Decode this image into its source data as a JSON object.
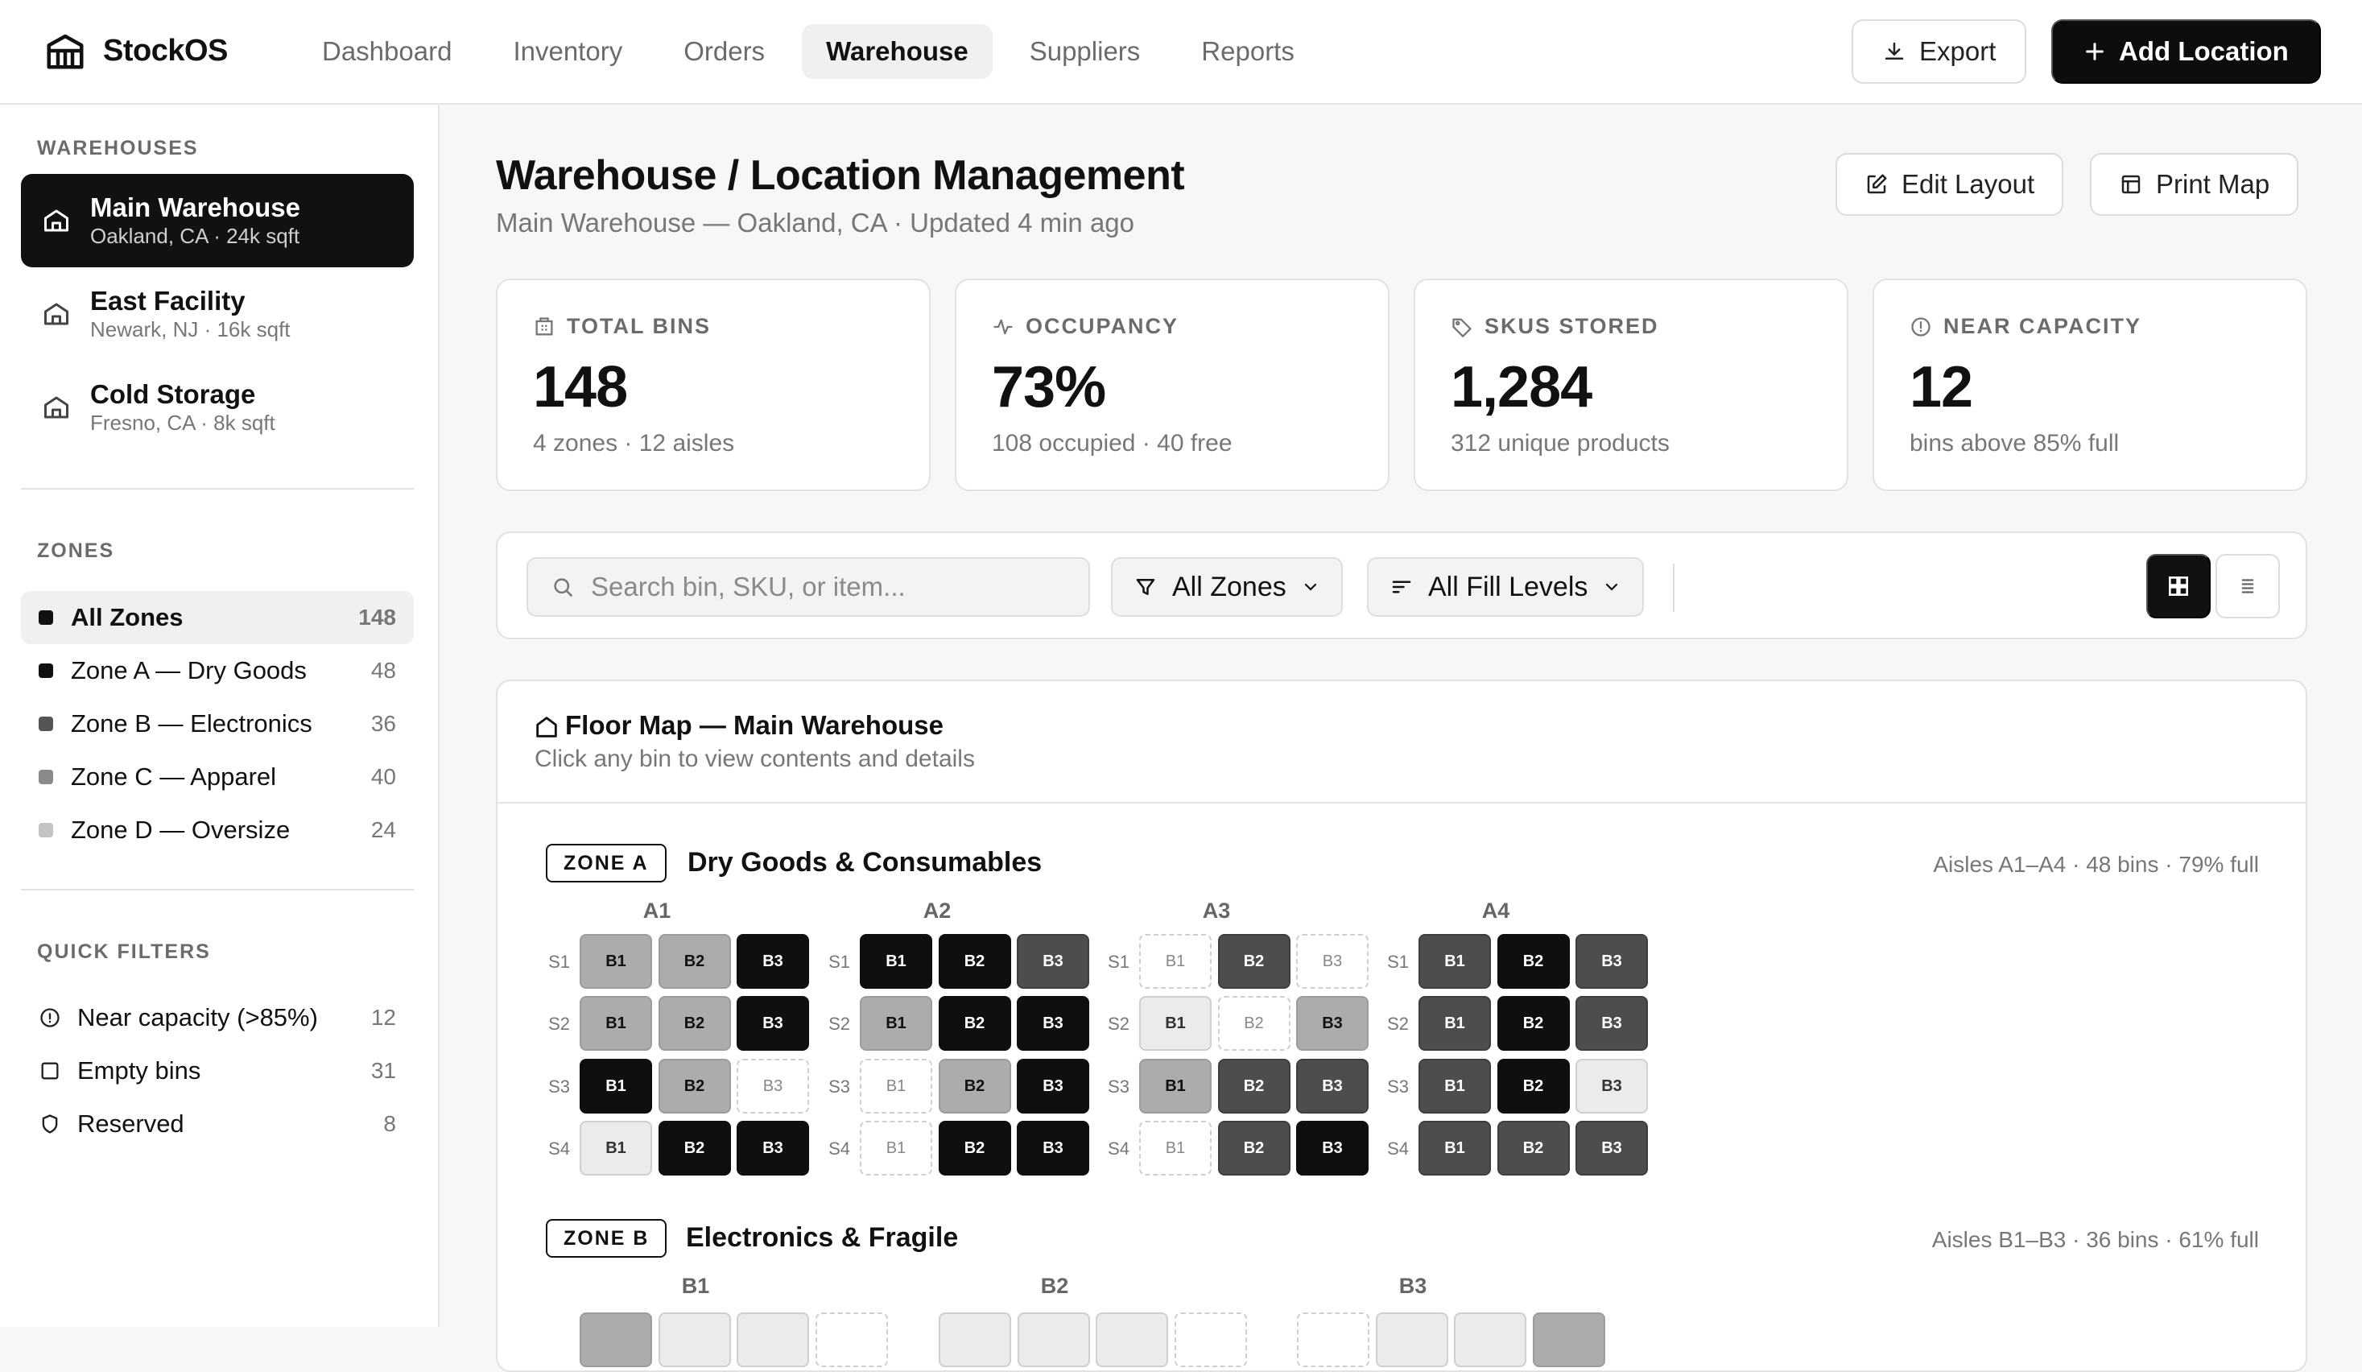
{
  "app": {
    "name": "StockOS"
  },
  "nav": {
    "items": [
      {
        "label": "Dashboard"
      },
      {
        "label": "Inventory"
      },
      {
        "label": "Orders"
      },
      {
        "label": "Warehouse",
        "active": true
      },
      {
        "label": "Suppliers"
      },
      {
        "label": "Reports"
      }
    ],
    "export_label": "Export",
    "add_label": "Add Location"
  },
  "sidebar": {
    "warehouses_heading": "WAREHOUSES",
    "warehouses": [
      {
        "name": "Main Warehouse",
        "meta": "Oakland, CA · 24k sqft",
        "active": true
      },
      {
        "name": "East Facility",
        "meta": "Newark, NJ · 16k sqft"
      },
      {
        "name": "Cold Storage",
        "meta": "Fresno, CA · 8k sqft"
      }
    ],
    "zones_heading": "ZONES",
    "zones": [
      {
        "label": "All Zones",
        "count": "148",
        "color": "#111111",
        "active": true
      },
      {
        "label": "Zone A — Dry Goods",
        "count": "48",
        "color": "#111111"
      },
      {
        "label": "Zone B — Electronics",
        "count": "36",
        "color": "#555555"
      },
      {
        "label": "Zone C — Apparel",
        "count": "40",
        "color": "#8a8a8a"
      },
      {
        "label": "Zone D — Oversize",
        "count": "24",
        "color": "#c4c4c4"
      }
    ],
    "quick_filters_heading": "QUICK FILTERS",
    "quick_filters": [
      {
        "label": "Near capacity (>85%)",
        "count": "12",
        "icon": "alert-circle-icon"
      },
      {
        "label": "Empty bins",
        "count": "31",
        "icon": "square-icon"
      },
      {
        "label": "Reserved",
        "count": "8",
        "icon": "shield-icon"
      }
    ]
  },
  "page": {
    "title": "Warehouse / Location Management",
    "subtitle": "Main Warehouse — Oakland, CA · Updated 4 min ago",
    "edit_label": "Edit Layout",
    "print_label": "Print Map"
  },
  "stats": [
    {
      "label": "TOTAL BINS",
      "value": "148",
      "sub": "4 zones · 12 aisles",
      "icon": "building-icon"
    },
    {
      "label": "OCCUPANCY",
      "value": "73%",
      "sub": "108 occupied · 40 free",
      "icon": "activity-icon"
    },
    {
      "label": "SKUS STORED",
      "value": "1,284",
      "sub": "312 unique products",
      "icon": "tag-icon"
    },
    {
      "label": "NEAR CAPACITY",
      "value": "12",
      "sub": "bins above 85% full",
      "icon": "alert-circle-icon"
    }
  ],
  "toolbar": {
    "search_placeholder": "Search bin, SKU, or item...",
    "zone_filter": "All Zones",
    "fill_filter": "All Fill Levels"
  },
  "floor_map": {
    "title": "Floor Map — Main Warehouse",
    "subtitle": "Click any bin to view contents and details",
    "zones": [
      {
        "badge": "ZONE A",
        "name": "Dry Goods & Consumables",
        "meta": "Aisles A1–A4 · 48 bins · 79% full",
        "aisles": [
          {
            "label": "A1",
            "shelves": [
              {
                "label": "S1",
                "bins": [
                  [
                    "B1",
                    "mid"
                  ],
                  [
                    "B2",
                    "mid"
                  ],
                  [
                    "B3",
                    "full"
                  ]
                ]
              },
              {
                "label": "S2",
                "bins": [
                  [
                    "B1",
                    "mid"
                  ],
                  [
                    "B2",
                    "mid"
                  ],
                  [
                    "B3",
                    "full"
                  ]
                ]
              },
              {
                "label": "S3",
                "bins": [
                  [
                    "B1",
                    "full"
                  ],
                  [
                    "B2",
                    "mid"
                  ],
                  [
                    "B3",
                    "empty"
                  ]
                ]
              },
              {
                "label": "S4",
                "bins": [
                  [
                    "B1",
                    "low"
                  ],
                  [
                    "B2",
                    "full"
                  ],
                  [
                    "B3",
                    "full"
                  ]
                ]
              }
            ]
          },
          {
            "label": "A2",
            "shelves": [
              {
                "label": "S1",
                "bins": [
                  [
                    "B1",
                    "full"
                  ],
                  [
                    "B2",
                    "full"
                  ],
                  [
                    "B3",
                    "high"
                  ]
                ]
              },
              {
                "label": "S2",
                "bins": [
                  [
                    "B1",
                    "mid"
                  ],
                  [
                    "B2",
                    "full"
                  ],
                  [
                    "B3",
                    "full"
                  ]
                ]
              },
              {
                "label": "S3",
                "bins": [
                  [
                    "B1",
                    "empty"
                  ],
                  [
                    "B2",
                    "mid"
                  ],
                  [
                    "B3",
                    "full"
                  ]
                ]
              },
              {
                "label": "S4",
                "bins": [
                  [
                    "B1",
                    "empty"
                  ],
                  [
                    "B2",
                    "full"
                  ],
                  [
                    "B3",
                    "full"
                  ]
                ]
              }
            ]
          },
          {
            "label": "A3",
            "shelves": [
              {
                "label": "S1",
                "bins": [
                  [
                    "B1",
                    "empty"
                  ],
                  [
                    "B2",
                    "high"
                  ],
                  [
                    "B3",
                    "empty"
                  ]
                ]
              },
              {
                "label": "S2",
                "bins": [
                  [
                    "B1",
                    "low"
                  ],
                  [
                    "B2",
                    "empty"
                  ],
                  [
                    "B3",
                    "mid"
                  ]
                ]
              },
              {
                "label": "S3",
                "bins": [
                  [
                    "B1",
                    "mid"
                  ],
                  [
                    "B2",
                    "high"
                  ],
                  [
                    "B3",
                    "high"
                  ]
                ]
              },
              {
                "label": "S4",
                "bins": [
                  [
                    "B1",
                    "empty"
                  ],
                  [
                    "B2",
                    "high"
                  ],
                  [
                    "B3",
                    "full"
                  ]
                ]
              }
            ]
          },
          {
            "label": "A4",
            "shelves": [
              {
                "label": "S1",
                "bins": [
                  [
                    "B1",
                    "high"
                  ],
                  [
                    "B2",
                    "full"
                  ],
                  [
                    "B3",
                    "high"
                  ]
                ]
              },
              {
                "label": "S2",
                "bins": [
                  [
                    "B1",
                    "high"
                  ],
                  [
                    "B2",
                    "full"
                  ],
                  [
                    "B3",
                    "high"
                  ]
                ]
              },
              {
                "label": "S3",
                "bins": [
                  [
                    "B1",
                    "high"
                  ],
                  [
                    "B2",
                    "full"
                  ],
                  [
                    "B3",
                    "low"
                  ]
                ]
              },
              {
                "label": "S4",
                "bins": [
                  [
                    "B1",
                    "high"
                  ],
                  [
                    "B2",
                    "high"
                  ],
                  [
                    "B3",
                    "high"
                  ]
                ]
              }
            ]
          }
        ]
      },
      {
        "badge": "ZONE B",
        "name": "Electronics & Fragile",
        "meta": "Aisles B1–B3 · 36 bins · 61% full",
        "aisles": [
          {
            "label": "B1",
            "first_row": [
              "mid",
              "low",
              "low",
              "empty"
            ]
          },
          {
            "label": "B2",
            "first_row": [
              "low",
              "low",
              "low",
              "empty"
            ]
          },
          {
            "label": "B3",
            "first_row": [
              "empty",
              "low",
              "low",
              "mid"
            ]
          }
        ]
      }
    ]
  },
  "colors": {
    "accent": "#0d0d0d",
    "bin_empty": "#ffffff",
    "bin_low": "#ebebeb",
    "bin_mid": "#acacac",
    "bin_high": "#4d4d4d",
    "bin_full": "#0f0f0f"
  }
}
